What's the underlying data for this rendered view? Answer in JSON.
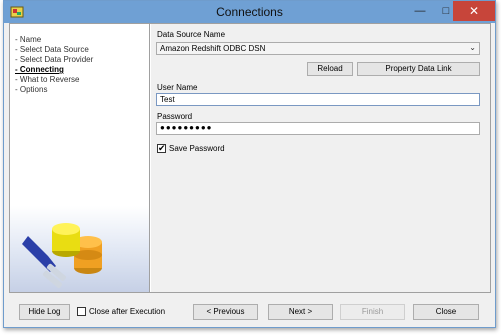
{
  "window": {
    "title": "Connections"
  },
  "nav": {
    "items": [
      {
        "label": "- Name",
        "active": false
      },
      {
        "label": "- Select Data Source",
        "active": false
      },
      {
        "label": "- Select Data Provider",
        "active": false
      },
      {
        "label": "- Connecting",
        "active": true
      },
      {
        "label": "- What to Reverse",
        "active": false
      },
      {
        "label": "- Options",
        "active": false
      }
    ]
  },
  "form": {
    "datasource_label": "Data Source Name",
    "datasource_value": "Amazon Redshift ODBC DSN",
    "reload_label": "Reload",
    "property_label": "Property Data Link",
    "username_label": "User Name",
    "username_value": "Test",
    "password_label": "Password",
    "password_mask": "●●●●●●●●●",
    "save_password_label": "Save Password",
    "save_password_checked": true
  },
  "footer": {
    "hide_log": "Hide Log",
    "close_after": "Close after Execution",
    "previous": "< Previous",
    "next": "Next >",
    "finish": "Finish",
    "close": "Close"
  },
  "colors": {
    "titlebar": "#6fa0d4",
    "close_button": "#c7453a",
    "focus_border": "#7a98c2"
  }
}
